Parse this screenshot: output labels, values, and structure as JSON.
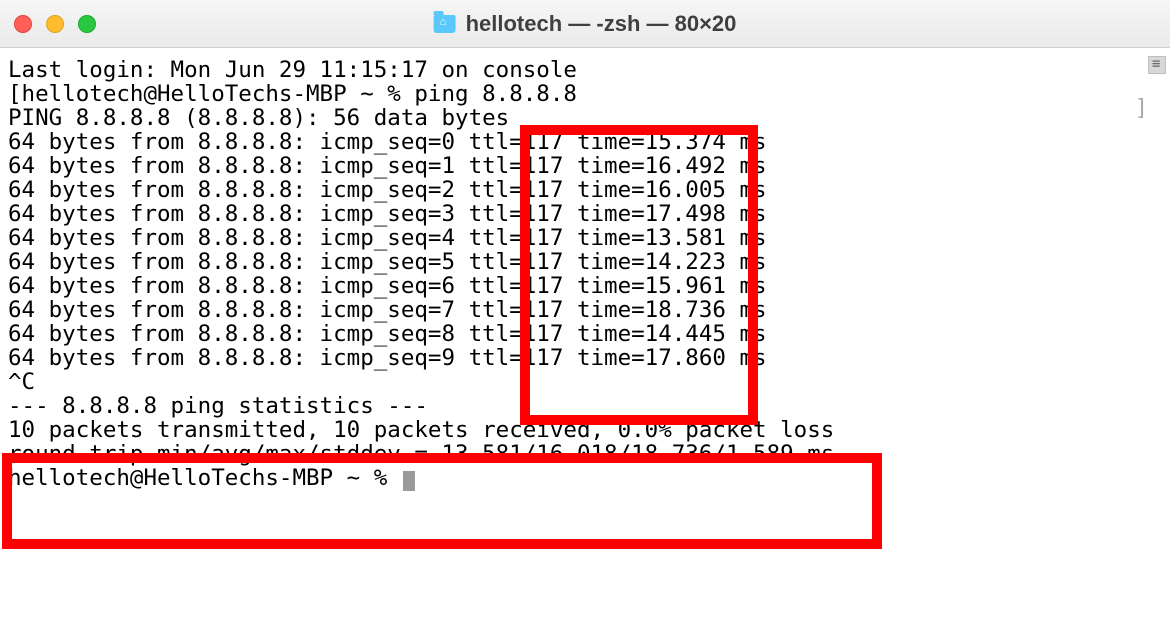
{
  "window": {
    "title": "hellotech — -zsh — 80×20"
  },
  "terminal": {
    "last_login": "Last login: Mon Jun 29 11:15:17 on console",
    "prompt1_open": "[",
    "prompt1": "hellotech@HelloTechs-MBP ~ % ",
    "command": "ping 8.8.8.8",
    "ping_header": "PING 8.8.8.8 (8.8.8.8): 56 data bytes",
    "replies": [
      "64 bytes from 8.8.8.8: icmp_seq=0 ttl=117 time=15.374 ms",
      "64 bytes from 8.8.8.8: icmp_seq=1 ttl=117 time=16.492 ms",
      "64 bytes from 8.8.8.8: icmp_seq=2 ttl=117 time=16.005 ms",
      "64 bytes from 8.8.8.8: icmp_seq=3 ttl=117 time=17.498 ms",
      "64 bytes from 8.8.8.8: icmp_seq=4 ttl=117 time=13.581 ms",
      "64 bytes from 8.8.8.8: icmp_seq=5 ttl=117 time=14.223 ms",
      "64 bytes from 8.8.8.8: icmp_seq=6 ttl=117 time=15.961 ms",
      "64 bytes from 8.8.8.8: icmp_seq=7 ttl=117 time=18.736 ms",
      "64 bytes from 8.8.8.8: icmp_seq=8 ttl=117 time=14.445 ms",
      "64 bytes from 8.8.8.8: icmp_seq=9 ttl=117 time=17.860 ms"
    ],
    "interrupt": "^C",
    "stats_header": "--- 8.8.8.8 ping statistics ---",
    "stats_line1": "10 packets transmitted, 10 packets received, 0.0% packet loss",
    "stats_line2": "round-trip min/avg/max/stddev = 13.581/16.018/18.736/1.589 ms",
    "prompt2": "hellotech@HelloTechs-MBP ~ % "
  }
}
